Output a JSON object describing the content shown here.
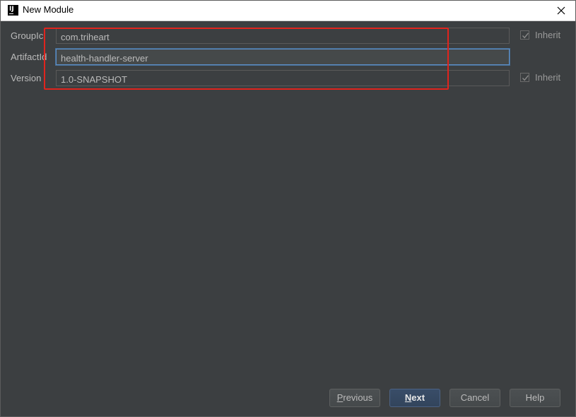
{
  "window": {
    "title": "New Module"
  },
  "form": {
    "group_id": {
      "label": "GroupIc",
      "value": "com.triheart",
      "inherit_label": "Inherit",
      "inherit_checked": true
    },
    "artifact_id": {
      "label": "ArtifactId",
      "value": "health-handler-server"
    },
    "version": {
      "label": "Version",
      "value": "1.0-SNAPSHOT",
      "inherit_label": "Inherit",
      "inherit_checked": true
    }
  },
  "buttons": {
    "previous": {
      "mnemonic": "P",
      "rest": "revious"
    },
    "next": {
      "mnemonic": "N",
      "rest": "ext"
    },
    "cancel": "Cancel",
    "help": "Help"
  },
  "colors": {
    "background": "#3c3f41",
    "field_background": "#45494a",
    "text": "#bbbbbb",
    "focus_border": "#5e8fc7",
    "highlight_annotation": "#e0241d",
    "primary_button": "#394d68"
  },
  "icons": {
    "app": "intellij-idea-icon",
    "close": "close-icon",
    "check": "checkmark-icon"
  }
}
